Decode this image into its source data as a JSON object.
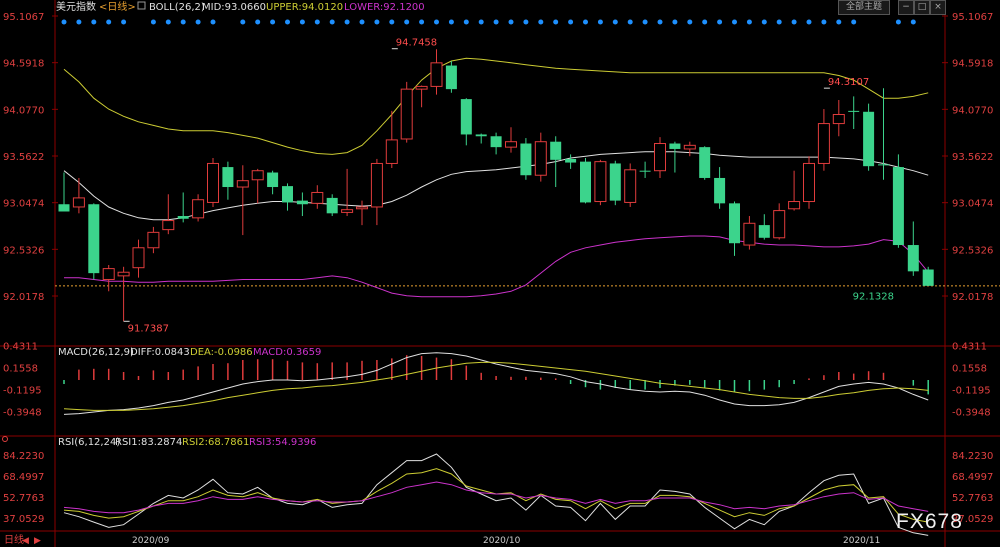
{
  "header": {
    "symbol": "美元指数",
    "period": "<日线>",
    "boll_label": "BOLL(26,2)",
    "mid_label": "MID:93.0660",
    "upper_label": "UPPER:94.0120",
    "lower_label": "LOWER:92.1200",
    "theme_button": "全部主题"
  },
  "macd_header": {
    "name": "MACD(26,12,9)",
    "diff": "DIFF:0.0843",
    "dea": "DEA:-0.0986",
    "macd": "MACD:0.3659"
  },
  "rsi_header": {
    "name": "RSI(6,12,24)",
    "rsi1": "RSI1:83.2874",
    "rsi2": "RSI2:68.7861",
    "rsi3": "RSI3:54.9396"
  },
  "bottom_bar": {
    "period_label": "日线",
    "x_ticks": [
      "2020/09",
      "2020/10",
      "2020/11"
    ]
  },
  "watermark": "FX678",
  "colors": {
    "up": "#e03c3c",
    "down": "#3cd48c",
    "mid": "#e0e0e0",
    "upper": "#cccc33",
    "lower": "#cc33cc",
    "axis_text": "#e04040",
    "grid": "#8b0000",
    "dots": "#1e90ff"
  },
  "chart_data": {
    "type": "candlestick",
    "price_axis": [
      "95.1067",
      "94.5918",
      "94.0770",
      "93.5622",
      "93.0474",
      "92.5326",
      "92.0178"
    ],
    "macd_axis": [
      "0.4311",
      "0.1558",
      "-0.1195",
      "-0.3948"
    ],
    "rsi_axis": [
      "84.2230",
      "68.4997",
      "52.7763",
      "37.0529"
    ],
    "annotations": [
      {
        "label": "94.7458",
        "value": 94.7458,
        "index": 22
      },
      {
        "label": "91.7387",
        "value": 91.7387,
        "index": 4
      },
      {
        "label": "94.3107",
        "value": 94.3107,
        "index": 51
      },
      {
        "label": "92.1328",
        "value": 92.1328,
        "index": 54
      }
    ],
    "last_price_line": 92.13,
    "candles": [
      [
        93.03,
        92.95,
        93.38,
        92.95
      ],
      [
        93.0,
        93.1,
        93.32,
        92.93
      ],
      [
        93.03,
        92.27,
        93.04,
        92.2
      ],
      [
        92.2,
        92.32,
        92.36,
        92.07
      ],
      [
        92.24,
        92.28,
        92.34,
        91.74
      ],
      [
        92.33,
        92.55,
        92.64,
        92.22
      ],
      [
        92.55,
        92.72,
        92.78,
        92.49
      ],
      [
        92.75,
        92.85,
        93.14,
        92.7
      ],
      [
        92.9,
        92.87,
        93.16,
        92.83
      ],
      [
        92.88,
        93.08,
        93.14,
        92.84
      ],
      [
        93.05,
        93.48,
        93.54,
        93.0
      ],
      [
        93.44,
        93.22,
        93.5,
        93.08
      ],
      [
        93.22,
        93.29,
        93.46,
        92.69
      ],
      [
        93.3,
        93.4,
        93.42,
        93.04
      ],
      [
        93.38,
        93.22,
        93.4,
        93.14
      ],
      [
        93.23,
        93.05,
        93.26,
        92.96
      ],
      [
        93.07,
        93.03,
        93.16,
        92.9
      ],
      [
        93.04,
        93.16,
        93.24,
        92.98
      ],
      [
        93.1,
        92.93,
        93.14,
        92.9
      ],
      [
        92.94,
        92.97,
        93.42,
        92.9
      ],
      [
        92.98,
        93.0,
        93.07,
        92.8
      ],
      [
        93.0,
        93.48,
        93.53,
        92.8
      ],
      [
        93.48,
        93.74,
        94.06,
        93.43
      ],
      [
        93.75,
        94.3,
        94.38,
        93.71
      ],
      [
        94.3,
        94.33,
        94.34,
        94.1
      ],
      [
        94.33,
        94.59,
        94.74,
        94.24
      ],
      [
        94.56,
        94.3,
        94.61,
        94.26
      ],
      [
        94.19,
        93.8,
        94.2,
        93.68
      ],
      [
        93.8,
        93.78,
        93.81,
        93.7
      ],
      [
        93.78,
        93.66,
        93.82,
        93.58
      ],
      [
        93.66,
        93.72,
        93.88,
        93.6
      ],
      [
        93.7,
        93.35,
        93.76,
        93.3
      ],
      [
        93.35,
        93.72,
        93.82,
        93.28
      ],
      [
        93.72,
        93.52,
        93.78,
        93.22
      ],
      [
        93.53,
        93.49,
        93.58,
        93.42
      ],
      [
        93.5,
        93.05,
        93.54,
        93.04
      ],
      [
        93.06,
        93.5,
        93.52,
        93.02
      ],
      [
        93.48,
        93.07,
        93.51,
        93.02
      ],
      [
        93.05,
        93.41,
        93.48,
        93.0
      ],
      [
        93.4,
        93.39,
        93.5,
        93.32
      ],
      [
        93.4,
        93.7,
        93.77,
        93.32
      ],
      [
        93.7,
        93.64,
        93.72,
        93.38
      ],
      [
        93.64,
        93.68,
        93.72,
        93.56
      ],
      [
        93.66,
        93.32,
        93.67,
        93.3
      ],
      [
        93.32,
        93.04,
        93.44,
        92.98
      ],
      [
        93.04,
        92.6,
        93.06,
        92.46
      ],
      [
        92.58,
        92.82,
        92.9,
        92.53
      ],
      [
        92.8,
        92.66,
        92.92,
        92.64
      ],
      [
        92.66,
        92.96,
        93.04,
        92.64
      ],
      [
        92.98,
        93.06,
        93.4,
        92.96
      ],
      [
        93.06,
        93.48,
        93.56,
        92.98
      ],
      [
        93.48,
        93.92,
        94.08,
        93.4
      ],
      [
        93.92,
        94.02,
        94.18,
        93.78
      ],
      [
        94.06,
        94.05,
        94.22,
        93.86
      ],
      [
        94.05,
        93.45,
        94.14,
        93.4
      ],
      [
        93.47,
        93.46,
        94.31,
        93.3
      ],
      [
        93.44,
        92.58,
        93.58,
        92.55
      ],
      [
        92.58,
        92.29,
        92.84,
        92.24
      ],
      [
        92.31,
        92.13,
        92.34,
        92.13
      ]
    ],
    "boll": {
      "upper": [
        94.52,
        94.38,
        94.2,
        94.08,
        94.0,
        93.94,
        93.9,
        93.86,
        93.84,
        93.84,
        93.84,
        93.82,
        93.79,
        93.76,
        93.71,
        93.66,
        93.62,
        93.59,
        93.58,
        93.6,
        93.68,
        93.84,
        94.02,
        94.22,
        94.4,
        94.53,
        94.61,
        94.64,
        94.63,
        94.61,
        94.59,
        94.57,
        94.55,
        94.53,
        94.52,
        94.51,
        94.5,
        94.49,
        94.48,
        94.48,
        94.48,
        94.48,
        94.48,
        94.48,
        94.48,
        94.48,
        94.48,
        94.48,
        94.48,
        94.48,
        94.48,
        94.48,
        94.45,
        94.4,
        94.3,
        94.2,
        94.2,
        94.22,
        94.26
      ],
      "mid": [
        93.4,
        93.27,
        93.12,
        93.0,
        92.93,
        92.88,
        92.86,
        92.86,
        92.88,
        92.92,
        92.96,
        92.99,
        93.02,
        93.04,
        93.06,
        93.06,
        93.05,
        93.04,
        93.03,
        93.02,
        93.01,
        93.02,
        93.06,
        93.13,
        93.22,
        93.3,
        93.36,
        93.39,
        93.4,
        93.41,
        93.43,
        93.45,
        93.47,
        93.5,
        93.54,
        93.56,
        93.58,
        93.59,
        93.6,
        93.61,
        93.61,
        93.61,
        93.6,
        93.59,
        93.57,
        93.56,
        93.55,
        93.55,
        93.55,
        93.55,
        93.55,
        93.55,
        93.54,
        93.53,
        93.51,
        93.48,
        93.44,
        93.4,
        93.35
      ],
      "lower": [
        92.22,
        92.22,
        92.2,
        92.18,
        92.18,
        92.17,
        92.17,
        92.18,
        92.18,
        92.18,
        92.18,
        92.19,
        92.2,
        92.2,
        92.2,
        92.2,
        92.2,
        92.22,
        92.24,
        92.22,
        92.17,
        92.11,
        92.05,
        92.02,
        92.01,
        92.01,
        92.01,
        92.01,
        92.02,
        92.04,
        92.07,
        92.14,
        92.27,
        92.4,
        92.5,
        92.55,
        92.58,
        92.61,
        92.63,
        92.65,
        92.66,
        92.67,
        92.68,
        92.68,
        92.67,
        92.63,
        92.61,
        92.59,
        92.58,
        92.58,
        92.57,
        92.56,
        92.56,
        92.57,
        92.59,
        92.64,
        92.62,
        92.48,
        92.28
      ]
    },
    "macd": {
      "diff": [
        -0.43,
        -0.42,
        -0.4,
        -0.38,
        -0.37,
        -0.35,
        -0.32,
        -0.28,
        -0.25,
        -0.2,
        -0.15,
        -0.1,
        -0.05,
        -0.02,
        0.0,
        0.0,
        -0.01,
        0.0,
        0.02,
        0.04,
        0.07,
        0.12,
        0.2,
        0.28,
        0.33,
        0.34,
        0.33,
        0.3,
        0.25,
        0.2,
        0.16,
        0.12,
        0.1,
        0.08,
        0.04,
        -0.02,
        -0.05,
        -0.09,
        -0.12,
        -0.14,
        -0.15,
        -0.14,
        -0.15,
        -0.19,
        -0.25,
        -0.3,
        -0.32,
        -0.32,
        -0.31,
        -0.28,
        -0.22,
        -0.15,
        -0.08,
        -0.05,
        -0.03,
        -0.05,
        -0.1,
        -0.18,
        -0.25
      ],
      "dea": [
        -0.36,
        -0.37,
        -0.38,
        -0.38,
        -0.38,
        -0.37,
        -0.36,
        -0.34,
        -0.32,
        -0.29,
        -0.26,
        -0.22,
        -0.19,
        -0.16,
        -0.13,
        -0.11,
        -0.1,
        -0.08,
        -0.07,
        -0.05,
        -0.03,
        0.0,
        0.03,
        0.07,
        0.11,
        0.15,
        0.18,
        0.21,
        0.22,
        0.22,
        0.21,
        0.19,
        0.17,
        0.15,
        0.13,
        0.11,
        0.08,
        0.05,
        0.02,
        -0.01,
        -0.04,
        -0.06,
        -0.08,
        -0.1,
        -0.12,
        -0.15,
        -0.18,
        -0.2,
        -0.22,
        -0.23,
        -0.23,
        -0.21,
        -0.18,
        -0.16,
        -0.13,
        -0.11,
        -0.1,
        -0.11,
        -0.13
      ],
      "bars": [
        -0.05,
        0.13,
        0.14,
        0.14,
        0.1,
        0.05,
        0.12,
        0.1,
        0.13,
        0.17,
        0.2,
        0.21,
        0.25,
        0.26,
        0.26,
        0.24,
        0.22,
        0.21,
        0.22,
        0.22,
        0.24,
        0.25,
        0.27,
        0.31,
        0.3,
        0.28,
        0.26,
        0.18,
        0.09,
        0.05,
        0.04,
        0.04,
        0.03,
        0.02,
        -0.05,
        -0.09,
        -0.12,
        -0.1,
        -0.12,
        -0.12,
        -0.1,
        -0.07,
        -0.06,
        -0.1,
        -0.13,
        -0.15,
        -0.14,
        -0.12,
        -0.09,
        -0.05,
        0.02,
        0.06,
        0.1,
        0.08,
        0.11,
        0.09,
        0.0,
        -0.07,
        -0.18
      ]
    },
    "rsi": {
      "rsi1": [
        41,
        38,
        34,
        30,
        32,
        40,
        48,
        54,
        52,
        58,
        66,
        56,
        55,
        60,
        52,
        48,
        47,
        51,
        45,
        47,
        48,
        62,
        71,
        80,
        80,
        85,
        75,
        60,
        55,
        50,
        52,
        43,
        54,
        46,
        45,
        35,
        48,
        36,
        46,
        46,
        58,
        57,
        55,
        45,
        37,
        29,
        36,
        32,
        42,
        46,
        56,
        65,
        69,
        70,
        48,
        52,
        30,
        26,
        24
      ],
      "rsi2": [
        43,
        42,
        39,
        37,
        38,
        42,
        46,
        50,
        50,
        53,
        58,
        54,
        53,
        56,
        52,
        50,
        49,
        51,
        48,
        49,
        50,
        57,
        63,
        70,
        71,
        74,
        70,
        61,
        58,
        55,
        56,
        50,
        55,
        51,
        50,
        44,
        50,
        44,
        48,
        48,
        54,
        54,
        53,
        48,
        43,
        38,
        41,
        39,
        44,
        46,
        52,
        58,
        61,
        62,
        52,
        53,
        40,
        36,
        34
      ],
      "rsi3": [
        45,
        44,
        42,
        41,
        41,
        43,
        46,
        48,
        48,
        50,
        53,
        51,
        51,
        53,
        51,
        50,
        49,
        50,
        49,
        49,
        50,
        53,
        56,
        60,
        62,
        64,
        62,
        58,
        56,
        55,
        55,
        52,
        54,
        52,
        51,
        48,
        51,
        48,
        50,
        50,
        52,
        52,
        52,
        49,
        47,
        44,
        45,
        44,
        46,
        47,
        50,
        53,
        55,
        56,
        51,
        52,
        46,
        44,
        42
      ]
    }
  }
}
